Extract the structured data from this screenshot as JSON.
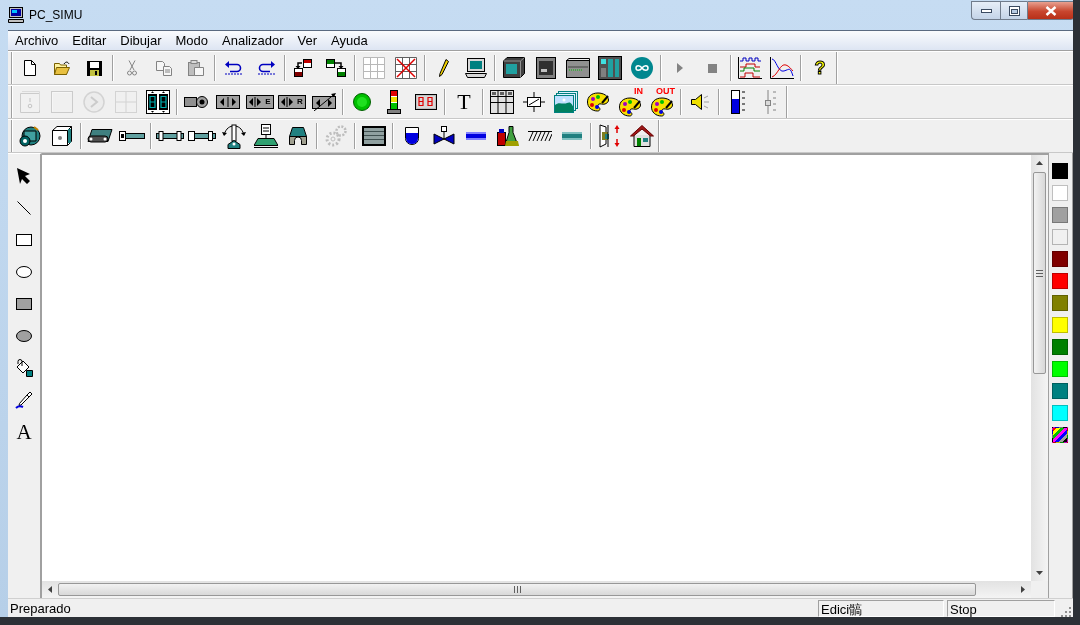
{
  "window": {
    "title": "PC_SIMU"
  },
  "menu": [
    "Archivo",
    "Editar",
    "Dibujar",
    "Modo",
    "Analizador",
    "Ver",
    "Ayuda"
  ],
  "toolbars": [
    [
      [
        {
          "disabled": false
        },
        {
          "disabled": false
        },
        {
          "disabled": false
        }
      ],
      [
        {
          "disabled": true
        },
        {
          "disabled": true
        },
        {
          "disabled": true
        }
      ],
      [
        {
          "disabled": false
        },
        {
          "disabled": false
        }
      ],
      [
        {
          "disabled": false
        },
        {
          "disabled": false
        }
      ],
      [
        {
          "disabled": false
        },
        {
          "disabled": false
        }
      ],
      [
        {
          "disabled": false
        },
        {
          "disabled": false
        }
      ],
      [
        {
          "disabled": false
        },
        {
          "disabled": false
        },
        {
          "disabled": false
        },
        {
          "disabled": false
        },
        {
          "disabled": false
        }
      ],
      [
        {
          "disabled": true
        },
        {
          "disabled": true
        }
      ],
      [
        {
          "disabled": false
        },
        {
          "disabled": false
        }
      ],
      [
        {
          "disabled": false,
          "glyph": "?"
        }
      ]
    ],
    [
      [
        {
          "disabled": true
        },
        {
          "disabled": true
        },
        {
          "disabled": true
        },
        {
          "disabled": true
        },
        {
          "disabled": false
        }
      ],
      [
        {
          "disabled": false
        },
        {
          "disabled": false
        },
        {
          "disabled": false,
          "badge": "E"
        },
        {
          "disabled": false,
          "badge": "R"
        },
        {
          "disabled": false
        }
      ],
      [
        {
          "disabled": false
        },
        {
          "disabled": false
        },
        {
          "disabled": false
        }
      ],
      [
        {
          "disabled": false,
          "glyph": "T"
        }
      ],
      [
        {
          "disabled": false
        },
        {
          "disabled": false
        },
        {
          "disabled": false
        },
        {
          "disabled": false
        },
        {
          "disabled": false,
          "badge": "IN"
        },
        {
          "disabled": false,
          "badge": "OUT"
        }
      ],
      [
        {
          "disabled": false
        }
      ],
      [
        {
          "disabled": false
        },
        {
          "disabled": true
        }
      ]
    ],
    [
      [
        {
          "disabled": false
        },
        {
          "disabled": false
        }
      ],
      [
        {
          "disabled": false
        },
        {
          "disabled": false
        }
      ],
      [
        {
          "disabled": false
        },
        {
          "disabled": false
        },
        {
          "disabled": false
        },
        {
          "disabled": false
        },
        {
          "disabled": false
        }
      ],
      [
        {
          "disabled": true
        }
      ],
      [
        {
          "disabled": false
        }
      ],
      [
        {
          "disabled": false
        },
        {
          "disabled": false
        },
        {
          "disabled": false
        },
        {
          "disabled": false
        },
        {
          "disabled": false
        },
        {
          "disabled": false
        }
      ],
      [
        {
          "disabled": false
        },
        {
          "disabled": false
        }
      ]
    ]
  ],
  "toolbox": [
    {
      "selected": false
    },
    {
      "selected": false
    },
    {
      "selected": false
    },
    {
      "selected": false
    },
    {
      "selected": false
    },
    {
      "selected": false
    },
    {
      "selected": false
    },
    {
      "selected": false
    },
    {
      "selected": false,
      "glyph": "A"
    }
  ],
  "palette": [
    {
      "kind": "solid",
      "color": "#000000"
    },
    {
      "kind": "solid",
      "color": "#ffffff"
    },
    {
      "kind": "solid",
      "color": "#a0a0a0"
    },
    {
      "kind": "solid",
      "color": "#f0f0f0"
    },
    {
      "kind": "solid",
      "color": "#800000"
    },
    {
      "kind": "solid",
      "color": "#ff0000"
    },
    {
      "kind": "solid",
      "color": "#808000"
    },
    {
      "kind": "solid",
      "color": "#ffff00"
    },
    {
      "kind": "solid",
      "color": "#008000"
    },
    {
      "kind": "solid",
      "color": "#00ff00"
    },
    {
      "kind": "solid",
      "color": "#008080"
    },
    {
      "kind": "solid",
      "color": "#00ffff"
    },
    {
      "kind": "striped"
    }
  ],
  "status_bar": {
    "message": "Preparado",
    "panels": [
      "Edici髇",
      "Stop"
    ]
  }
}
